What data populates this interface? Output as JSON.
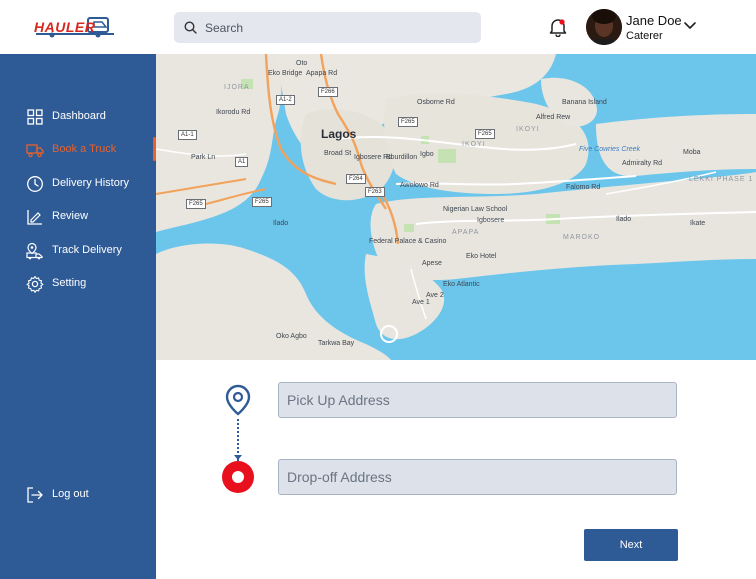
{
  "brand": {
    "name": "HAULER",
    "accent": "#d6281f"
  },
  "header": {
    "search_placeholder": "Search",
    "user": {
      "name": "Jane Doe",
      "role": "Caterer"
    }
  },
  "sidebar": {
    "background": "#2e5a96",
    "active_color": "#e8622c",
    "items": [
      {
        "label": "Dashboard",
        "icon": "grid-icon",
        "active": false
      },
      {
        "label": "Book a Truck",
        "icon": "truck-icon",
        "active": true
      },
      {
        "label": "Delivery History",
        "icon": "clock-icon",
        "active": false
      },
      {
        "label": "Review",
        "icon": "review-icon",
        "active": false
      },
      {
        "label": "Track Delivery",
        "icon": "track-icon",
        "active": false
      },
      {
        "label": "Setting",
        "icon": "gear-icon",
        "active": false
      }
    ],
    "logout_label": "Log out"
  },
  "map": {
    "labels": {
      "lagos": "Lagos",
      "oto": "Oto",
      "ijora": "IJORA",
      "park_ln": "Park Ln",
      "ilado_w": "Ilado",
      "oko_agbo": "Oko Agbo",
      "tarkwa_bay": "Tarkwa Bay",
      "igbo": "Igbo",
      "ikoyi1": "IKOYI",
      "ikoyi2": "IKOYI",
      "banana_island": "Banana Island",
      "five_cowries": "Five Cowries Creek",
      "moba": "Moba",
      "lekki_phase": "LEKKI PHASE 1",
      "admiralty": "Admiralty Rd",
      "ilado_e": "Ilado",
      "ikate": "Ikate",
      "maroko": "MAROKO",
      "igbosere": "Igbosere",
      "apapa": "APAPA",
      "eko_hotel": "Eko Hotel",
      "apese": "Apese",
      "eko_atlantic": "Eko Atlantic",
      "nigerian_law_school": "Nigerian Law School",
      "federal_palace": "Federal Palace & Casino",
      "osborne": "Osborne Rd",
      "awolowo": "Awolowo Rd",
      "broad_st": "Broad St",
      "igbosere_rd": "Igbosere Rd",
      "bourdillon": "Bourdillon",
      "eko_bridge": "Eko Bridge",
      "ikorodu": "Ikorodu Rd",
      "apapa_rd": "Apapa Rd",
      "ave1": "Ave 1",
      "ave2": "Ave 2",
      "alfred": "Alfred Rew",
      "falomo": "Falomo Rd"
    },
    "shields": {
      "a12": "A1-2",
      "f266": "F266",
      "f265a": "F265",
      "f265b": "F265",
      "f265c": "F265",
      "f265d": "F265",
      "f264": "F264",
      "f263": "F263",
      "a11": "A1-1",
      "a1": "A1"
    }
  },
  "form": {
    "pickup_placeholder": "Pick Up Address",
    "dropoff_placeholder": "Drop-off Address",
    "next_label": "Next"
  }
}
